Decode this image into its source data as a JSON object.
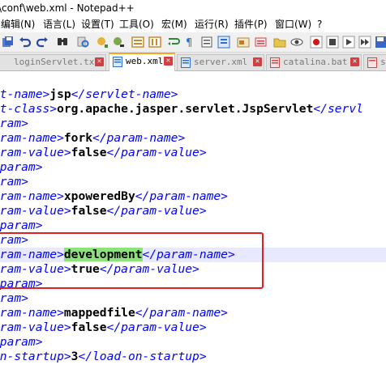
{
  "window": {
    "title": "\\conf\\web.xml - Notepad++"
  },
  "menu": [
    {
      "label": "编辑(N)"
    },
    {
      "label": "语言(L)"
    },
    {
      "label": "设置(T)"
    },
    {
      "label": "工具(O)"
    },
    {
      "label": "宏(M)"
    },
    {
      "label": "运行(R)"
    },
    {
      "label": "插件(P)"
    },
    {
      "label": "窗口(W)"
    },
    {
      "label": "?"
    }
  ],
  "tabs": [
    {
      "label": "loginServlet.txt",
      "active": false
    },
    {
      "label": "web.xml",
      "active": true
    },
    {
      "label": "server.xml",
      "active": false
    },
    {
      "label": "catalina.bat",
      "active": false
    },
    {
      "label": "sprin",
      "active": false
    }
  ],
  "editor": {
    "lines": [
      {
        "tok": [
          {
            "c": "t",
            "v": "et-name>"
          },
          {
            "c": "x",
            "v": "jsp"
          },
          {
            "c": "t",
            "v": "</servlet-name>"
          }
        ]
      },
      {
        "tok": [
          {
            "c": "t",
            "v": "et-class>"
          },
          {
            "c": "x",
            "v": "org.apache.jasper.servlet.JspServlet"
          },
          {
            "c": "t",
            "v": "</servl"
          }
        ]
      },
      {
        "tok": [
          {
            "c": "t",
            "v": "aram>"
          }
        ]
      },
      {
        "tok": [
          {
            "c": "t",
            "v": "aram-name>"
          },
          {
            "c": "x",
            "v": "fork"
          },
          {
            "c": "t",
            "v": "</param-name>"
          }
        ]
      },
      {
        "tok": [
          {
            "c": "t",
            "v": "aram-value>"
          },
          {
            "c": "x",
            "v": "false"
          },
          {
            "c": "t",
            "v": "</param-value>"
          }
        ]
      },
      {
        "tok": [
          {
            "c": "t",
            "v": "-param>"
          }
        ]
      },
      {
        "tok": [
          {
            "c": "t",
            "v": "aram>"
          }
        ]
      },
      {
        "tok": [
          {
            "c": "t",
            "v": "aram-name>"
          },
          {
            "c": "x",
            "v": "xpoweredBy"
          },
          {
            "c": "t",
            "v": "</param-name>"
          }
        ]
      },
      {
        "tok": [
          {
            "c": "t",
            "v": "aram-value>"
          },
          {
            "c": "x",
            "v": "false"
          },
          {
            "c": "t",
            "v": "</param-value>"
          }
        ]
      },
      {
        "tok": [
          {
            "c": "t",
            "v": "-param>"
          }
        ]
      },
      {
        "tok": [
          {
            "c": "t",
            "v": "aram>"
          }
        ]
      },
      {
        "tok": [
          {
            "c": "t",
            "v": "aram-name>"
          },
          {
            "c": "h",
            "v": "development"
          },
          {
            "c": "t",
            "v": "</param-name>"
          }
        ],
        "current": true
      },
      {
        "tok": [
          {
            "c": "t",
            "v": "aram-value>"
          },
          {
            "c": "x",
            "v": "true"
          },
          {
            "c": "t",
            "v": "</param-value>"
          }
        ]
      },
      {
        "tok": [
          {
            "c": "t",
            "v": "-param>"
          }
        ]
      },
      {
        "tok": [
          {
            "c": "t",
            "v": "aram>"
          }
        ]
      },
      {
        "tok": [
          {
            "c": "t",
            "v": "aram-name>"
          },
          {
            "c": "x",
            "v": "mappedfile"
          },
          {
            "c": "t",
            "v": "</param-name>"
          }
        ]
      },
      {
        "tok": [
          {
            "c": "t",
            "v": "aram-value>"
          },
          {
            "c": "x",
            "v": "false"
          },
          {
            "c": "t",
            "v": "</param-value>"
          }
        ]
      },
      {
        "tok": [
          {
            "c": "t",
            "v": "-param>"
          }
        ]
      },
      {
        "tok": [
          {
            "c": "t",
            "v": "on-startup>"
          },
          {
            "c": "x",
            "v": "3"
          },
          {
            "c": "t",
            "v": "</load-on-startup>"
          }
        ]
      }
    ]
  },
  "colors": {
    "tag": "#0000ff",
    "text": "#000000",
    "find_highlight": "#8ee27c",
    "current_line": "#e8e8ff",
    "annotation_box": "#e02020",
    "active_tab_accent": "#f5a623"
  },
  "toolbar_icons": [
    "save-all-icon",
    "close-icon",
    "undo-icon",
    "redo-icon",
    "find-icon",
    "replace-icon",
    "zoom-in-icon",
    "zoom-out-icon",
    "sync-v-icon",
    "sync-h-icon",
    "wrap-icon",
    "show-all-chars-icon",
    "indent-guide-icon",
    "lang-icon",
    "doc-map-icon",
    "func-list-icon",
    "folder-icon",
    "monitor-icon",
    "record-icon",
    "stop-icon",
    "play-icon",
    "play-multi-icon",
    "save-macro-icon"
  ]
}
